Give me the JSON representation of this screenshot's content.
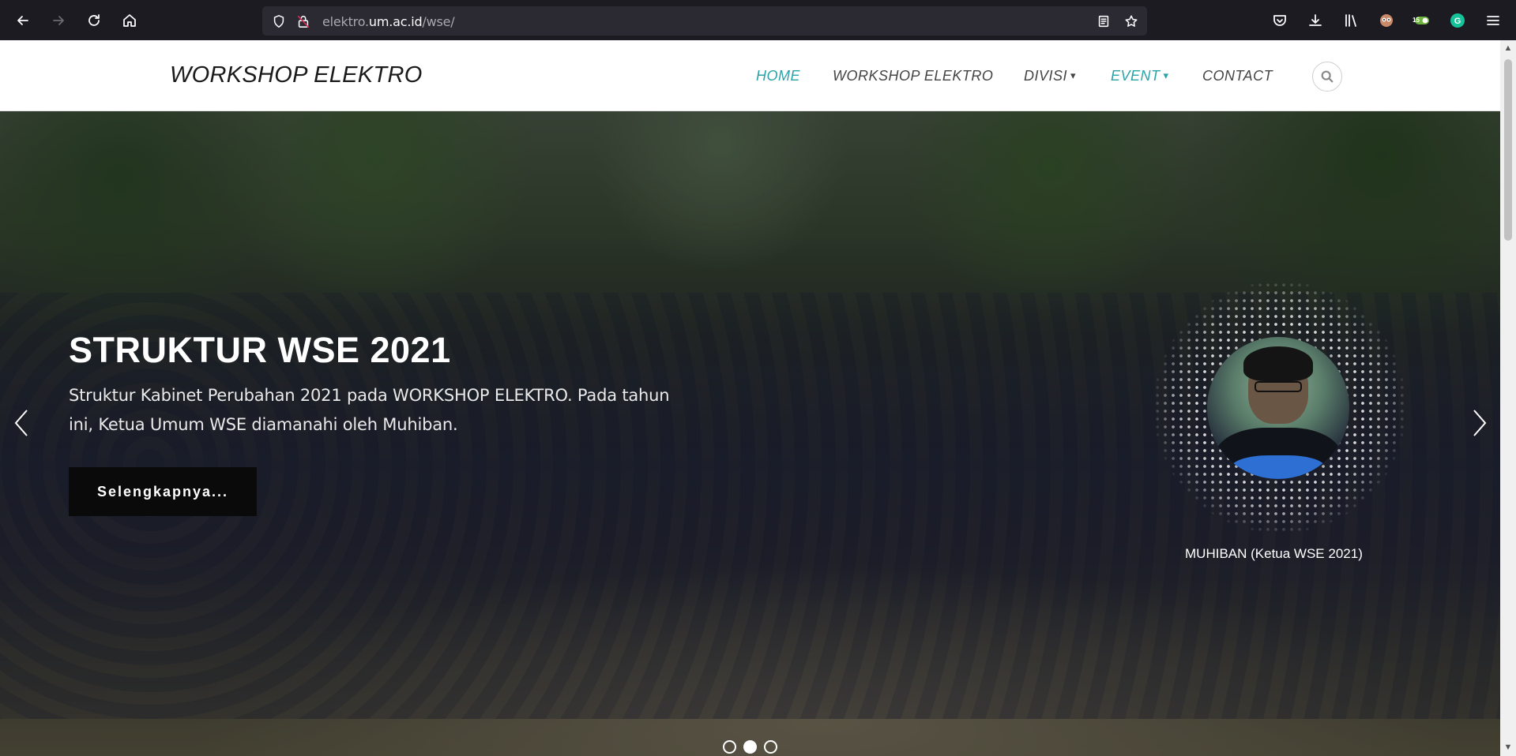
{
  "browser": {
    "url_prefix": "elektro.",
    "url_domain": "um.ac.id",
    "url_path": "/wse/",
    "icons": {
      "back": "back-arrow-icon",
      "forward": "forward-arrow-icon",
      "reload": "reload-icon",
      "home": "home-icon",
      "shield": "tracking-protection-icon",
      "lock": "insecure-lock-icon",
      "reader": "reader-view-icon",
      "bookmark": "bookmark-star-icon",
      "pocket": "pocket-icon",
      "downloads": "downloads-icon",
      "library": "library-icon",
      "menu": "hamburger-menu-icon"
    },
    "extension_badge": "15"
  },
  "site": {
    "logo": "WORKSHOP ELEKTRO",
    "nav": [
      {
        "label": "HOME",
        "active": true,
        "dropdown": false
      },
      {
        "label": "WORKSHOP ELEKTRO",
        "active": false,
        "dropdown": false
      },
      {
        "label": "DIVISI",
        "active": false,
        "dropdown": true
      },
      {
        "label": "EVENT",
        "active": true,
        "dropdown": true
      },
      {
        "label": "CONTACT",
        "active": false,
        "dropdown": false
      }
    ],
    "accent_color": "#2aa3a8"
  },
  "hero": {
    "title": "STRUKTUR WSE 2021",
    "description": "Struktur Kabinet Perubahan 2021 pada WORKSHOP ELEKTRO. Pada tahun ini, Ketua Umum WSE diamanahi oleh Muhiban.",
    "button_label": "Selengkapnya...",
    "portrait_caption": "MUHIBAN (Ketua WSE 2021)",
    "active_slide": 2,
    "slide_count": 3
  }
}
